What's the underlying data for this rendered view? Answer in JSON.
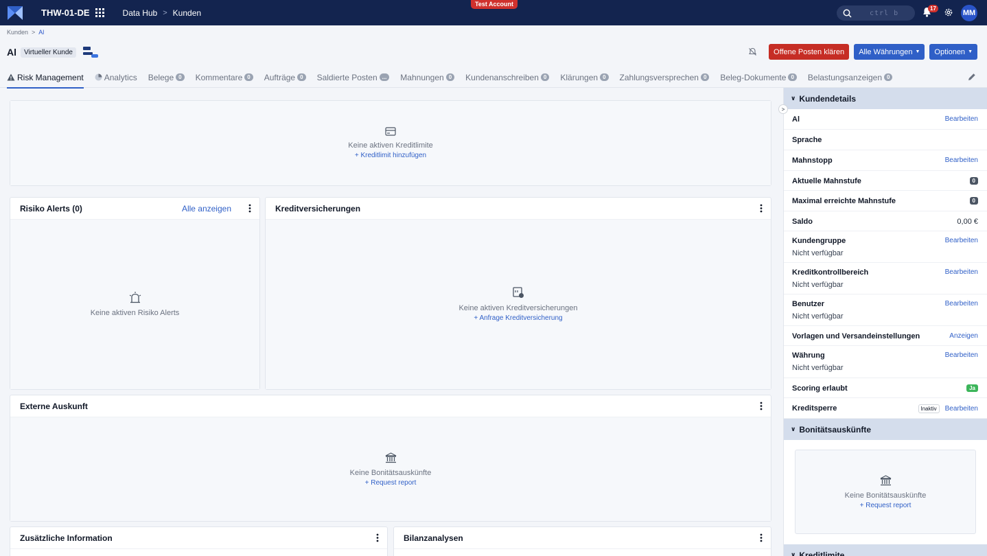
{
  "topbar": {
    "tenant": "THW-01-DE",
    "crumbs": [
      "Data Hub",
      "Kunden"
    ],
    "test_badge": "Test Account",
    "search_kbd": "ctrl b",
    "notification_count": "17",
    "user_initials": "MM"
  },
  "breadcrumb": [
    "Kunden",
    "Al"
  ],
  "header": {
    "title": "Al",
    "badge": "Virtueller Kunde",
    "buttons": {
      "offene_posten": "Offene Posten klären",
      "waehrungen": "Alle Währungen",
      "optionen": "Optionen"
    }
  },
  "tabs": [
    {
      "label": "Risk Management",
      "count": null
    },
    {
      "label": "Analytics",
      "count": null
    },
    {
      "label": "Belege",
      "count": "0"
    },
    {
      "label": "Kommentare",
      "count": "0"
    },
    {
      "label": "Aufträge",
      "count": "0"
    },
    {
      "label": "Saldierte Posten",
      "count": "..."
    },
    {
      "label": "Mahnungen",
      "count": "0"
    },
    {
      "label": "Kundenanschreiben",
      "count": "0"
    },
    {
      "label": "Klärungen",
      "count": "0"
    },
    {
      "label": "Zahlungsversprechen",
      "count": "0"
    },
    {
      "label": "Beleg-Dokumente",
      "count": "0"
    },
    {
      "label": "Belastungsanzeigen",
      "count": "0"
    }
  ],
  "cards": {
    "kreditlimite": {
      "empty": "Keine aktiven Kreditlimite",
      "action": "+ Kreditlimit hinzufügen"
    },
    "risiko": {
      "title": "Risiko Alerts (0)",
      "link": "Alle anzeigen",
      "empty": "Keine aktiven Risiko Alerts"
    },
    "kreditvers": {
      "title": "Kreditversicherungen",
      "empty": "Keine aktiven Kreditversicherungen",
      "action": "+ Anfrage Kreditversicherung"
    },
    "extern": {
      "title": "Externe Auskunft",
      "empty": "Keine Bonitätsauskünfte",
      "action": "+ Request report"
    },
    "zusatz": {
      "title": "Zusätzliche Information"
    },
    "bilanz": {
      "title": "Bilanzanalysen"
    }
  },
  "panel": {
    "kundendetails_title": "Kundendetails",
    "rows": [
      {
        "label": "Al",
        "link": "Bearbeiten"
      },
      {
        "label": "Sprache"
      },
      {
        "label": "Mahnstopp",
        "link": "Bearbeiten"
      },
      {
        "label": "Aktuelle Mahnstufe",
        "badge": "0"
      },
      {
        "label": "Maximal erreichte Mahnstufe",
        "badge": "0"
      },
      {
        "label": "Saldo",
        "value": "0,00 €"
      },
      {
        "label": "Kundengruppe",
        "sub": "Nicht verfügbar",
        "link": "Bearbeiten"
      },
      {
        "label": "Kreditkontrollbereich",
        "sub": "Nicht verfügbar",
        "link": "Bearbeiten"
      },
      {
        "label": "Benutzer",
        "sub": "Nicht verfügbar",
        "link": "Bearbeiten"
      },
      {
        "label": "Vorlagen und Versandeinstellungen",
        "link": "Anzeigen"
      },
      {
        "label": "Währung",
        "sub": "Nicht verfügbar",
        "link": "Bearbeiten"
      },
      {
        "label": "Scoring erlaubt",
        "badge": "Ja"
      },
      {
        "label": "Kreditsperre",
        "badge": "Inaktiv",
        "link": "Bearbeiten"
      }
    ],
    "bonitaet_title": "Bonitätsauskünfte",
    "bonitaet_empty": "Keine Bonitätsauskünfte",
    "bonitaet_action": "+ Request report",
    "kreditlimite_title": "Kreditlimite"
  }
}
